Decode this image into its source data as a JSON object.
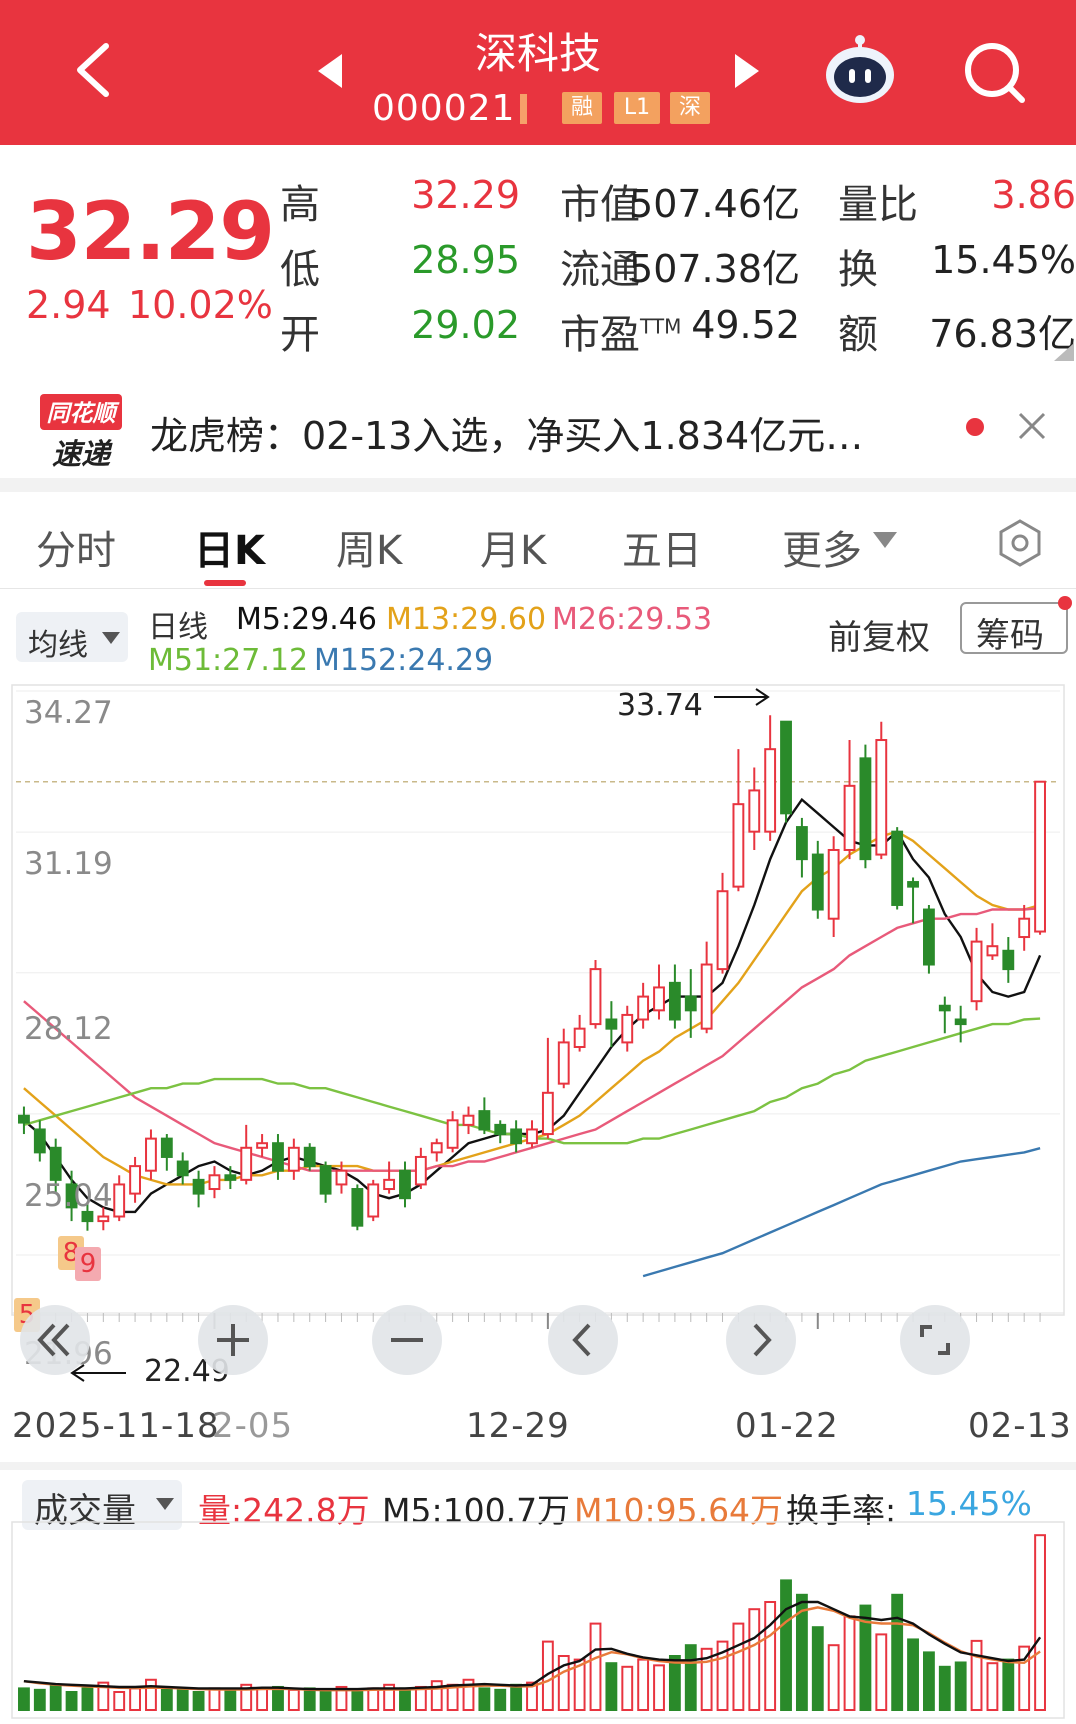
{
  "header": {
    "stock_name": "深科技",
    "stock_code": "000021",
    "tags": [
      "融",
      "L1",
      "深"
    ]
  },
  "quote": {
    "price": "32.29",
    "change": "2.94",
    "change_pct": "10.02%",
    "high_label": "高",
    "high": "32.29",
    "low_label": "低",
    "low": "28.95",
    "open_label": "开",
    "open": "29.02",
    "mktcap_label": "市值",
    "mktcap": "507.46亿",
    "float_label": "流通",
    "float": "507.38亿",
    "pe_label": "市盈",
    "pe_sup": "TTM",
    "pe": "49.52",
    "volratio_label": "量比",
    "volratio": "3.86",
    "turnover_label": "换",
    "turnover": "15.45%",
    "amount_label": "额",
    "amount": "76.83亿"
  },
  "banner": {
    "logo_top": "同花顺",
    "logo_bottom": "速递",
    "text": "龙虎榜：02-13入选，净买入1.834亿元…"
  },
  "tabs": [
    "分时",
    "日K",
    "周K",
    "月K",
    "五日",
    "更多"
  ],
  "active_tab": "日K",
  "ma": {
    "button_label": "均线",
    "period": "日线",
    "m5": "M5:29.46",
    "m13": "M13:29.60",
    "m26": "M26:29.53",
    "m51": "M51:27.12",
    "m152": "M152:24.29",
    "fq_label": "前复权",
    "chip_label": "筹码"
  },
  "colors": {
    "up": "#e8343f",
    "down": "#2a8a2a",
    "m5": "#111111",
    "m13": "#e3a21a",
    "m26": "#e85a7a",
    "m51": "#7cc242",
    "m152": "#3a79b0",
    "header_bg": "#e8343f"
  },
  "chart": {
    "y_ticks": [
      "34.27",
      "31.19",
      "28.12",
      "25.04",
      "21.96"
    ],
    "high_marker": "33.74",
    "low_marker": "22.49",
    "x_labels": [
      "2025-11-18",
      "2-05",
      "12-29",
      "01-22",
      "02-13"
    ],
    "badges": [
      "8",
      "9",
      "5"
    ]
  },
  "chart_data": {
    "type": "candlestick",
    "title": "深科技 000021 日K",
    "x_range": [
      "2025-11-18",
      "02-13"
    ],
    "ylim": [
      21.96,
      34.27
    ],
    "y_ticks": [
      34.27,
      31.19,
      28.12,
      25.04,
      21.96
    ],
    "candles": [
      {
        "o": 25.0,
        "c": 24.85,
        "h": 25.2,
        "l": 24.6
      },
      {
        "o": 24.7,
        "c": 24.2,
        "h": 24.9,
        "l": 24.0
      },
      {
        "o": 24.3,
        "c": 23.6,
        "h": 24.5,
        "l": 23.3
      },
      {
        "o": 23.5,
        "c": 23.0,
        "h": 23.8,
        "l": 22.7
      },
      {
        "o": 22.9,
        "c": 22.7,
        "h": 23.1,
        "l": 22.49
      },
      {
        "o": 22.7,
        "c": 22.8,
        "h": 23.0,
        "l": 22.5
      },
      {
        "o": 22.8,
        "c": 23.5,
        "h": 23.7,
        "l": 22.7
      },
      {
        "o": 23.3,
        "c": 23.9,
        "h": 24.1,
        "l": 23.1
      },
      {
        "o": 23.8,
        "c": 24.5,
        "h": 24.7,
        "l": 23.6
      },
      {
        "o": 24.5,
        "c": 24.1,
        "h": 24.6,
        "l": 23.8
      },
      {
        "o": 24.0,
        "c": 23.7,
        "h": 24.2,
        "l": 23.5
      },
      {
        "o": 23.6,
        "c": 23.3,
        "h": 23.8,
        "l": 23.0
      },
      {
        "o": 23.4,
        "c": 23.7,
        "h": 23.9,
        "l": 23.2
      },
      {
        "o": 23.7,
        "c": 23.6,
        "h": 23.9,
        "l": 23.4
      },
      {
        "o": 23.6,
        "c": 24.3,
        "h": 24.8,
        "l": 23.5
      },
      {
        "o": 24.3,
        "c": 24.4,
        "h": 24.6,
        "l": 24.1
      },
      {
        "o": 24.4,
        "c": 23.8,
        "h": 24.6,
        "l": 23.6
      },
      {
        "o": 23.8,
        "c": 24.3,
        "h": 24.5,
        "l": 23.6
      },
      {
        "o": 24.3,
        "c": 23.9,
        "h": 24.4,
        "l": 23.8
      },
      {
        "o": 23.9,
        "c": 23.3,
        "h": 24.0,
        "l": 23.1
      },
      {
        "o": 23.5,
        "c": 23.8,
        "h": 24.0,
        "l": 23.3
      },
      {
        "o": 23.4,
        "c": 22.6,
        "h": 23.5,
        "l": 22.5
      },
      {
        "o": 22.8,
        "c": 23.5,
        "h": 23.6,
        "l": 22.7
      },
      {
        "o": 23.4,
        "c": 23.6,
        "h": 24.0,
        "l": 23.3
      },
      {
        "o": 23.8,
        "c": 23.2,
        "h": 24.0,
        "l": 23.0
      },
      {
        "o": 23.5,
        "c": 24.1,
        "h": 24.3,
        "l": 23.4
      },
      {
        "o": 24.2,
        "c": 24.4,
        "h": 24.5,
        "l": 24.0
      },
      {
        "o": 24.3,
        "c": 24.9,
        "h": 25.1,
        "l": 24.2
      },
      {
        "o": 24.8,
        "c": 25.0,
        "h": 25.2,
        "l": 24.6
      },
      {
        "o": 25.1,
        "c": 24.7,
        "h": 25.4,
        "l": 24.6
      },
      {
        "o": 24.8,
        "c": 24.6,
        "h": 24.9,
        "l": 24.4
      },
      {
        "o": 24.7,
        "c": 24.4,
        "h": 24.9,
        "l": 24.2
      },
      {
        "o": 24.4,
        "c": 24.7,
        "h": 24.9,
        "l": 24.3
      },
      {
        "o": 24.6,
        "c": 25.5,
        "h": 26.7,
        "l": 24.5
      },
      {
        "o": 25.7,
        "c": 26.6,
        "h": 26.9,
        "l": 25.6
      },
      {
        "o": 26.5,
        "c": 26.9,
        "h": 27.2,
        "l": 26.4
      },
      {
        "o": 27.0,
        "c": 28.2,
        "h": 28.4,
        "l": 26.9
      },
      {
        "o": 27.1,
        "c": 26.9,
        "h": 27.5,
        "l": 26.5
      },
      {
        "o": 26.6,
        "c": 27.2,
        "h": 27.4,
        "l": 26.4
      },
      {
        "o": 27.1,
        "c": 27.6,
        "h": 27.9,
        "l": 26.9
      },
      {
        "o": 27.3,
        "c": 27.8,
        "h": 28.3,
        "l": 27.1
      },
      {
        "o": 27.9,
        "c": 27.1,
        "h": 28.3,
        "l": 26.9
      },
      {
        "o": 27.6,
        "c": 27.3,
        "h": 28.2,
        "l": 26.7
      },
      {
        "o": 26.9,
        "c": 28.3,
        "h": 28.8,
        "l": 26.8
      },
      {
        "o": 28.2,
        "c": 29.9,
        "h": 30.3,
        "l": 28.1
      },
      {
        "o": 30.0,
        "c": 31.8,
        "h": 33.0,
        "l": 29.9
      },
      {
        "o": 31.2,
        "c": 32.1,
        "h": 32.6,
        "l": 30.8
      },
      {
        "o": 31.2,
        "c": 33.0,
        "h": 33.74,
        "l": 31.0
      },
      {
        "o": 33.6,
        "c": 31.6,
        "h": 33.6,
        "l": 31.4
      },
      {
        "o": 31.3,
        "c": 30.6,
        "h": 31.5,
        "l": 30.2
      },
      {
        "o": 30.7,
        "c": 29.5,
        "h": 31.0,
        "l": 29.3
      },
      {
        "o": 29.3,
        "c": 30.8,
        "h": 31.1,
        "l": 28.9
      },
      {
        "o": 30.8,
        "c": 32.2,
        "h": 33.2,
        "l": 30.6
      },
      {
        "o": 32.8,
        "c": 30.6,
        "h": 33.1,
        "l": 30.4
      },
      {
        "o": 30.7,
        "c": 33.2,
        "h": 33.6,
        "l": 30.6
      },
      {
        "o": 31.2,
        "c": 29.6,
        "h": 31.3,
        "l": 29.5
      },
      {
        "o": 30.1,
        "c": 30.0,
        "h": 30.2,
        "l": 29.2
      },
      {
        "o": 29.5,
        "c": 28.3,
        "h": 29.6,
        "l": 28.1
      },
      {
        "o": 27.4,
        "c": 27.3,
        "h": 27.6,
        "l": 26.8
      },
      {
        "o": 27.1,
        "c": 27.0,
        "h": 27.4,
        "l": 26.6
      },
      {
        "o": 27.5,
        "c": 28.8,
        "h": 29.1,
        "l": 27.3
      },
      {
        "o": 28.5,
        "c": 28.7,
        "h": 29.2,
        "l": 28.4
      },
      {
        "o": 28.6,
        "c": 28.2,
        "h": 28.9,
        "l": 27.9
      },
      {
        "o": 28.9,
        "c": 29.3,
        "h": 29.6,
        "l": 28.6
      },
      {
        "o": 29.02,
        "c": 32.29,
        "h": 32.29,
        "l": 28.95
      }
    ],
    "series": [
      {
        "name": "M5",
        "values": [
          24.9,
          24.6,
          24.1,
          23.6,
          23.2,
          23.0,
          22.9,
          22.9,
          23.3,
          23.5,
          23.7,
          23.9,
          24.0,
          23.8,
          23.7,
          23.8,
          24.0,
          24.1,
          24.0,
          23.9,
          23.8,
          23.6,
          23.3,
          23.2,
          23.3,
          23.5,
          23.8,
          24.1,
          24.4,
          24.5,
          24.6,
          24.6,
          24.6,
          24.7,
          25.0,
          25.5,
          26.0,
          26.5,
          26.9,
          27.2,
          27.4,
          27.6,
          27.6,
          27.6,
          27.9,
          28.7,
          29.6,
          30.6,
          31.4,
          31.9,
          31.6,
          31.3,
          31.0,
          30.9,
          30.9,
          31.2,
          30.6,
          30.2,
          29.4,
          28.9,
          28.1,
          27.7,
          27.6,
          27.7,
          28.5
        ]
      },
      {
        "name": "M13",
        "values": [
          25.6,
          25.3,
          25.0,
          24.7,
          24.4,
          24.1,
          23.9,
          23.7,
          23.6,
          23.5,
          23.5,
          23.5,
          23.6,
          23.6,
          23.7,
          23.7,
          23.8,
          23.8,
          23.9,
          23.9,
          23.9,
          23.9,
          23.8,
          23.8,
          23.8,
          23.8,
          23.9,
          24.0,
          24.1,
          24.2,
          24.3,
          24.4,
          24.5,
          24.6,
          24.8,
          25.0,
          25.3,
          25.6,
          25.9,
          26.2,
          26.4,
          26.7,
          26.9,
          27.1,
          27.5,
          27.9,
          28.4,
          28.9,
          29.4,
          29.9,
          30.2,
          30.4,
          30.7,
          30.9,
          31.1,
          31.2,
          31.0,
          30.7,
          30.4,
          30.1,
          29.8,
          29.6,
          29.5,
          29.5,
          29.6
        ]
      },
      {
        "name": "M26",
        "values": [
          27.5,
          27.2,
          26.9,
          26.6,
          26.3,
          26.0,
          25.7,
          25.4,
          25.2,
          25.0,
          24.8,
          24.6,
          24.4,
          24.3,
          24.2,
          24.1,
          24.0,
          23.9,
          23.8,
          23.8,
          23.8,
          23.8,
          23.8,
          23.8,
          23.8,
          23.8,
          23.9,
          23.9,
          24.0,
          24.0,
          24.1,
          24.2,
          24.3,
          24.4,
          24.5,
          24.6,
          24.7,
          24.9,
          25.1,
          25.3,
          25.5,
          25.7,
          25.9,
          26.1,
          26.3,
          26.6,
          26.9,
          27.2,
          27.5,
          27.8,
          28.0,
          28.2,
          28.5,
          28.7,
          28.9,
          29.1,
          29.2,
          29.3,
          29.3,
          29.4,
          29.4,
          29.5,
          29.5,
          29.5,
          29.53
        ]
      },
      {
        "name": "M51",
        "values": [
          24.8,
          24.9,
          25.0,
          25.1,
          25.2,
          25.3,
          25.4,
          25.5,
          25.6,
          25.6,
          25.7,
          25.7,
          25.8,
          25.8,
          25.8,
          25.8,
          25.7,
          25.7,
          25.6,
          25.6,
          25.5,
          25.4,
          25.3,
          25.2,
          25.1,
          25.0,
          24.9,
          24.8,
          24.8,
          24.7,
          24.6,
          24.6,
          24.5,
          24.5,
          24.4,
          24.4,
          24.4,
          24.4,
          24.4,
          24.5,
          24.5,
          24.6,
          24.7,
          24.8,
          24.9,
          25.0,
          25.1,
          25.3,
          25.4,
          25.6,
          25.7,
          25.9,
          26.0,
          26.2,
          26.3,
          26.4,
          26.5,
          26.6,
          26.7,
          26.8,
          26.9,
          27.0,
          27.0,
          27.1,
          27.12
        ]
      },
      {
        "name": "M152",
        "values": [
          null,
          null,
          null,
          null,
          null,
          null,
          null,
          null,
          null,
          null,
          null,
          null,
          null,
          null,
          null,
          null,
          null,
          null,
          null,
          null,
          null,
          null,
          null,
          null,
          null,
          null,
          null,
          null,
          null,
          null,
          null,
          null,
          null,
          null,
          null,
          null,
          null,
          null,
          null,
          21.5,
          21.6,
          21.7,
          21.8,
          21.9,
          22.0,
          22.15,
          22.3,
          22.45,
          22.6,
          22.75,
          22.9,
          23.05,
          23.2,
          23.35,
          23.5,
          23.6,
          23.7,
          23.8,
          23.9,
          24.0,
          24.05,
          24.1,
          24.15,
          24.2,
          24.29
        ]
      }
    ],
    "volume": {
      "title": "成交量",
      "label_vol": "量:242.8万",
      "label_m5": "M5:100.7万",
      "label_m10": "M10:95.64万",
      "label_turnover_name": "换手率:",
      "label_turnover_value": "15.45%",
      "values": [
        30,
        28,
        35,
        25,
        30,
        38,
        25,
        30,
        42,
        30,
        28,
        25,
        30,
        28,
        35,
        30,
        32,
        28,
        30,
        25,
        32,
        28,
        30,
        35,
        30,
        32,
        40,
        35,
        42,
        30,
        28,
        35,
        38,
        95,
        75,
        70,
        120,
        65,
        60,
        70,
        62,
        75,
        90,
        85,
        95,
        120,
        140,
        150,
        180,
        160,
        115,
        90,
        130,
        145,
        105,
        160,
        98,
        80,
        60,
        66,
        96,
        65,
        70,
        88,
        242.8
      ],
      "m5": [
        40,
        38,
        36,
        35,
        34,
        33,
        32,
        32,
        33,
        32,
        31,
        30,
        30,
        30,
        30,
        31,
        31,
        30,
        29,
        29,
        29,
        29,
        30,
        30,
        30,
        31,
        32,
        34,
        35,
        36,
        35,
        34,
        35,
        50,
        62,
        68,
        84,
        85,
        78,
        73,
        70,
        69,
        69,
        72,
        80,
        90,
        100,
        118,
        140,
        150,
        150,
        140,
        130,
        128,
        125,
        128,
        120,
        105,
        92,
        80,
        76,
        72,
        68,
        70,
        101
      ]
    }
  }
}
